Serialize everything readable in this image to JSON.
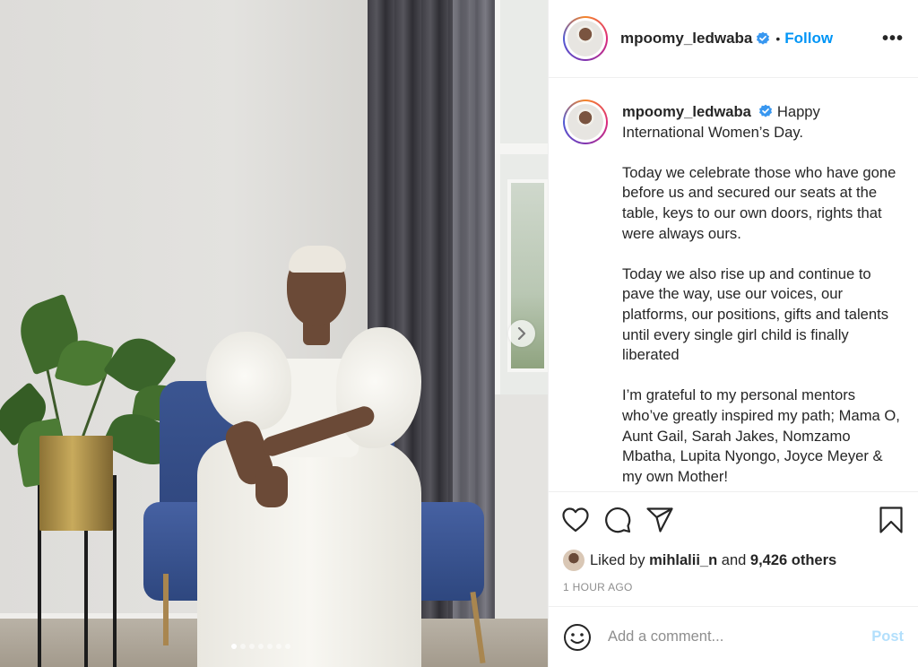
{
  "header": {
    "username": "mpoomy_ledwaba",
    "separator": "•",
    "follow_label": "Follow",
    "more_label": "•••"
  },
  "caption": {
    "username": "mpoomy_ledwaba",
    "text": "Happy International Women’s Day.\n\nToday we celebrate those who have gone before us and secured our seats at the table, keys to our own doors, rights that were always ours.\n\nToday we also rise up and continue to pave the way, use our voices, our platforms, our positions, gifts and talents until every single girl child is finally liberated\n\nI’m grateful to my personal mentors who’ve greatly inspired my path; Mama O, Aunt Gail, Sarah Jakes, Nomzamo Mbatha, Lupita Nyongo, Joyce Meyer & my own Mother!"
  },
  "likes": {
    "prefix": "Liked by",
    "first_user": "mihlalii_n",
    "conjunction": "and",
    "others": "9,426 others"
  },
  "timestamp": "1 HOUR AGO",
  "comment_box": {
    "placeholder": "Add a comment...",
    "post_label": "Post"
  },
  "carousel": {
    "total_slides": 7,
    "active_slide": 1
  },
  "icons": {
    "verified": "verified-badge-icon",
    "like": "heart-icon",
    "comment": "comment-bubble-icon",
    "share": "paper-plane-icon",
    "save": "bookmark-icon",
    "emoji": "smiley-icon",
    "next": "chevron-right-icon"
  },
  "colors": {
    "accent": "#0095f6",
    "verified": "#3897f0",
    "post_disabled": "#b2dffc",
    "muted": "#8e8e8e"
  }
}
